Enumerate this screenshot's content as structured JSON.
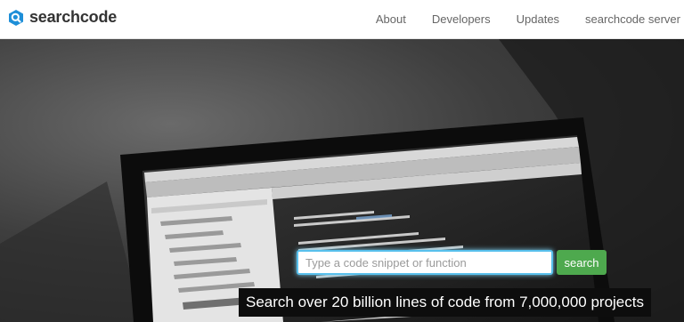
{
  "brand": {
    "name": "searchcode",
    "icon": "search-logo-icon",
    "color": "#1e8fd8"
  },
  "nav": {
    "items": [
      {
        "label": "About"
      },
      {
        "label": "Developers"
      },
      {
        "label": "Updates"
      },
      {
        "label": "searchcode server"
      }
    ]
  },
  "search": {
    "value": "",
    "placeholder": "Type a code snippet or function",
    "button_label": "search",
    "button_color": "#4ea94e",
    "focus_color": "#58c0ec"
  },
  "tagline": "Search over 20 billion lines of code from 7,000,000 projects"
}
